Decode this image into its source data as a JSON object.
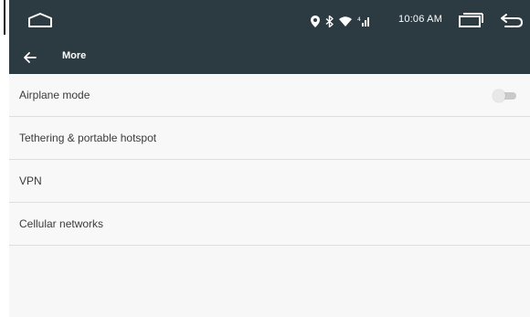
{
  "status_bar": {
    "time": "10:06 AM",
    "icons": [
      "location-icon",
      "bluetooth-icon",
      "wifi-icon",
      "cellular-signal-icon"
    ]
  },
  "nav_buttons": [
    "home-icon",
    "recents-icon",
    "back-icon"
  ],
  "app_bar": {
    "back_icon": "arrow-left-icon",
    "title": "More"
  },
  "settings": {
    "items": [
      {
        "label": "Airplane mode",
        "toggle": "off"
      },
      {
        "label": "Tethering & portable hotspot"
      },
      {
        "label": "VPN"
      },
      {
        "label": "Cellular networks"
      }
    ]
  },
  "colors": {
    "bar": "#2c3a41",
    "background": "#f7f7f7",
    "divider": "#dedede",
    "text": "#3b3b3b"
  }
}
